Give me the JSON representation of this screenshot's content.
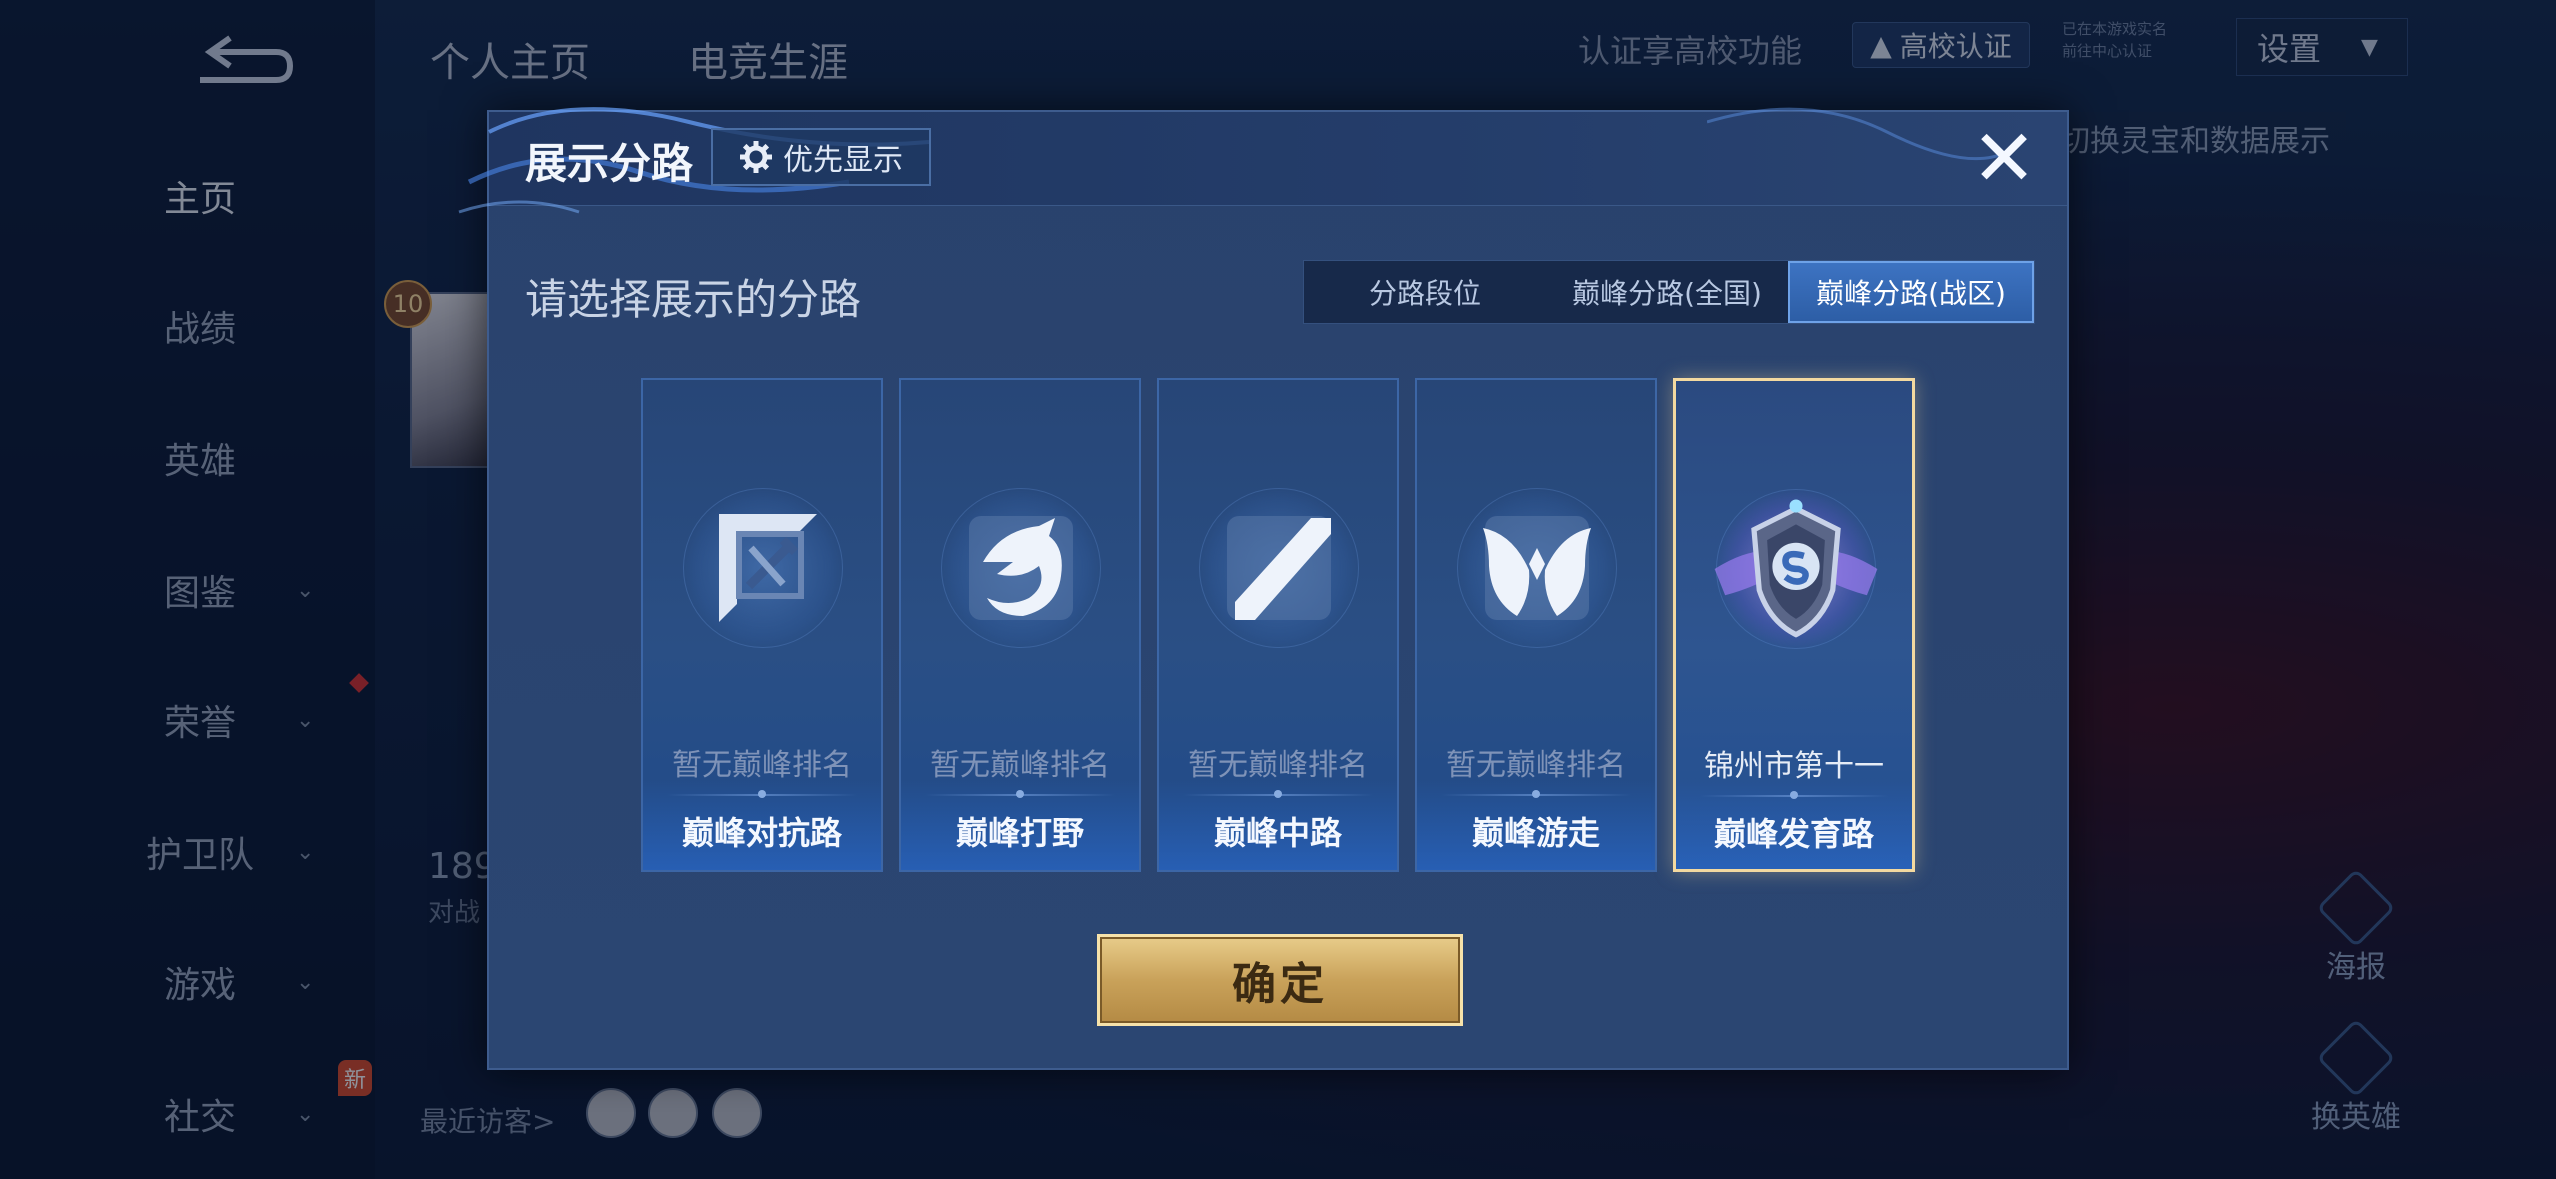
{
  "background": {
    "top_tabs": [
      "个人主页",
      "电竞生涯"
    ],
    "cert_prompt": "认证享高校功能",
    "cert_button": "高校认证",
    "cert_note_1": "已在本游戏实名",
    "cert_note_2": "前往中心认证",
    "settings_label": "设置",
    "switch_text": "切换灵宝和数据展示",
    "sidebar": [
      "主页",
      "战绩",
      "英雄",
      "图鉴",
      "荣誉",
      "护卫队",
      "游戏",
      "社交"
    ],
    "new_badge": "新",
    "level": "10",
    "stat_number": "189",
    "stat_label": "对战",
    "recent_visitors": "最近访客>",
    "poster_label": "海报",
    "change_hero_label": "换英雄"
  },
  "dialog": {
    "title": "展示分路",
    "priority_button": "优先显示",
    "close_icon": "close-icon",
    "section_title": "请选择展示的分路",
    "tabs": [
      {
        "label": "分路段位",
        "active": false
      },
      {
        "label": "巅峰分路(全国)",
        "active": false
      },
      {
        "label": "巅峰分路(战区)",
        "active": true
      }
    ],
    "cards": [
      {
        "rank": "暂无巅峰排名",
        "name": "巅峰对抗路",
        "icon": "sword-icon",
        "selected": false
      },
      {
        "rank": "暂无巅峰排名",
        "name": "巅峰打野",
        "icon": "dragon-icon",
        "selected": false
      },
      {
        "rank": "暂无巅峰排名",
        "name": "巅峰中路",
        "icon": "staff-icon",
        "selected": false
      },
      {
        "rank": "暂无巅峰排名",
        "name": "巅峰游走",
        "icon": "wings-icon",
        "selected": false
      },
      {
        "rank": "锦州市第十一",
        "name": "巅峰发育路",
        "icon": "shield-badge-icon",
        "selected": true
      }
    ],
    "confirm_button": "确定"
  },
  "colors": {
    "accent_blue": "#3d73c2",
    "selected_border": "#f3d9a0",
    "confirm_gold": "#c9a25a"
  }
}
